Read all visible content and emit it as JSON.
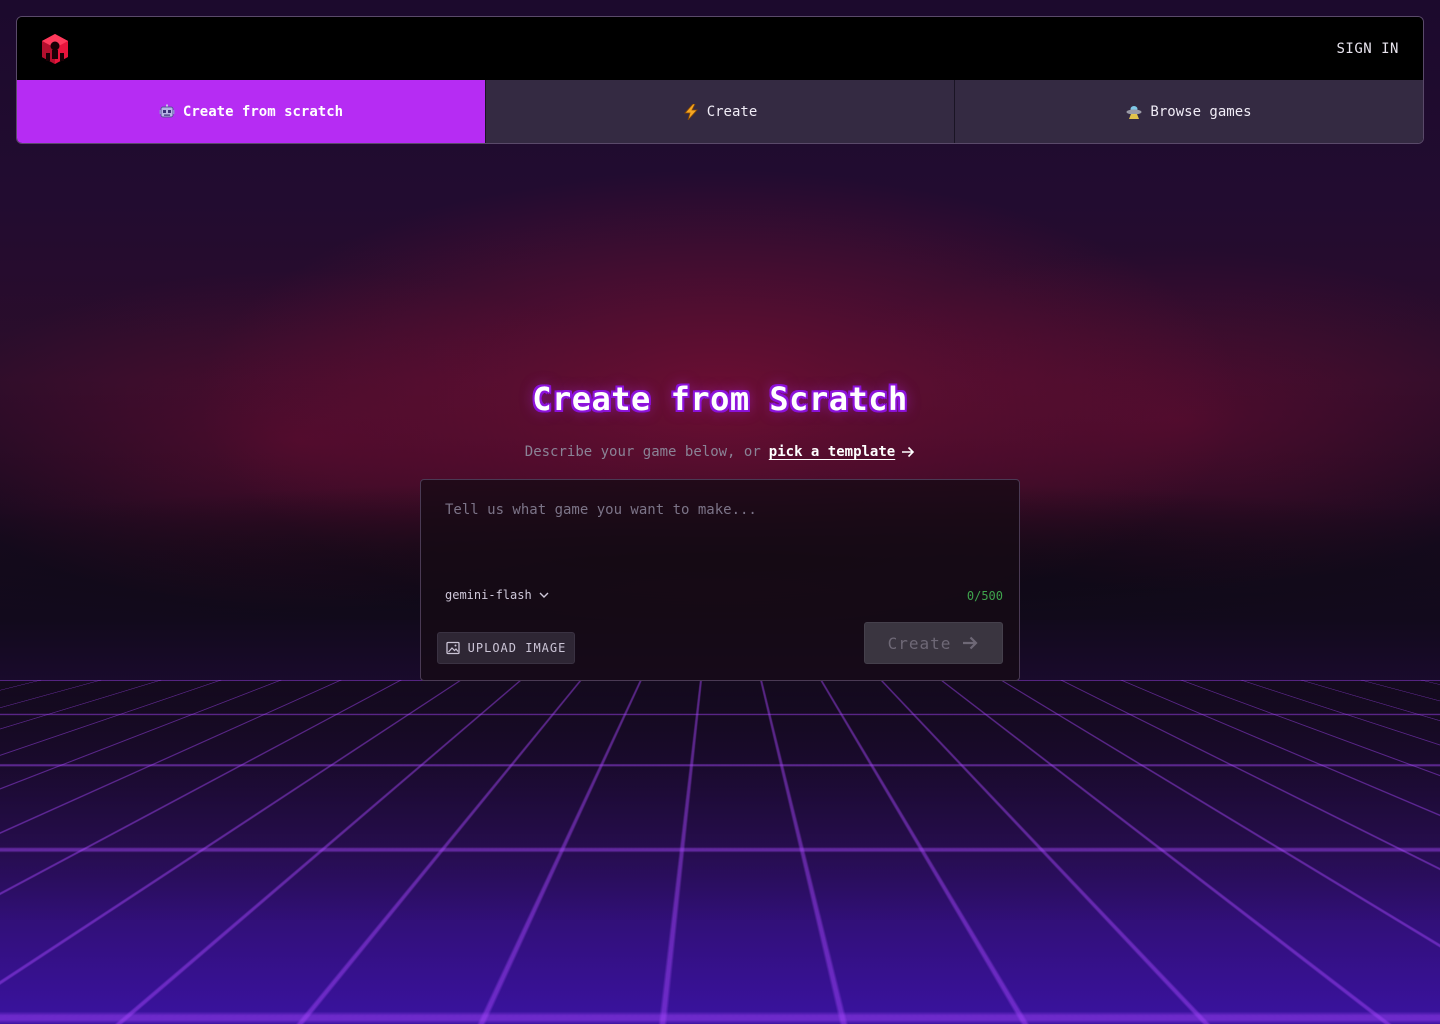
{
  "header": {
    "logo_icon": "red-cube-logo-icon",
    "sign_in_label": "SIGN IN"
  },
  "tabs": [
    {
      "label": "Create from scratch",
      "icon": "robot-icon",
      "active": true
    },
    {
      "label": "Create",
      "icon": "lightning-bolt-icon",
      "active": false
    },
    {
      "label": "Browse games",
      "icon": "ufo-icon",
      "active": false
    }
  ],
  "hero": {
    "title": "Create from Scratch",
    "subtitle_prefix": "Describe your game below, or",
    "template_link": "pick a template"
  },
  "composer": {
    "placeholder": "Tell us what game you want to make...",
    "value": "",
    "model": "gemini-flash",
    "counter": "0/500",
    "upload_label": "UPLOAD IMAGE",
    "create_label": "Create"
  },
  "colors": {
    "accent": "#b62cf3",
    "tab_inactive": "#342a42",
    "counter_green": "#3fa34d",
    "logo_red": "#e8143c"
  }
}
